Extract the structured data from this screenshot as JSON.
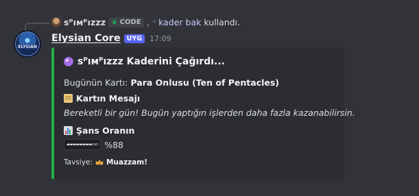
{
  "reply": {
    "username": "ꜱᴾıмᴾızzz",
    "command_chip": "CODE",
    "separator": ",",
    "command_name": "kader bak",
    "action": "kullandı."
  },
  "message": {
    "bot_name": "Elysian Core",
    "tag": "UYG",
    "time": "17:09"
  },
  "embed": {
    "accent_color": "#23b047",
    "title": "ꜱᴾıмᴾızzz Kaderini Çağırdı...",
    "card_label": "Bugünün Kartı:",
    "card_value": "Para Onlusu (Ten of Pentacles)",
    "message_heading": "Kartın Mesajı",
    "message_text": "Bereketli bir gün! Bugün yaptığın işlerden daha fazla kazanabilirsin.",
    "luck_heading": "Şans Oranın",
    "luck_bar": "▰▰▰▰▰▰▰▰▱▱",
    "luck_percent": "%88",
    "recommend_label": "Tavsiye:",
    "recommend_value": "Muazzam!"
  }
}
